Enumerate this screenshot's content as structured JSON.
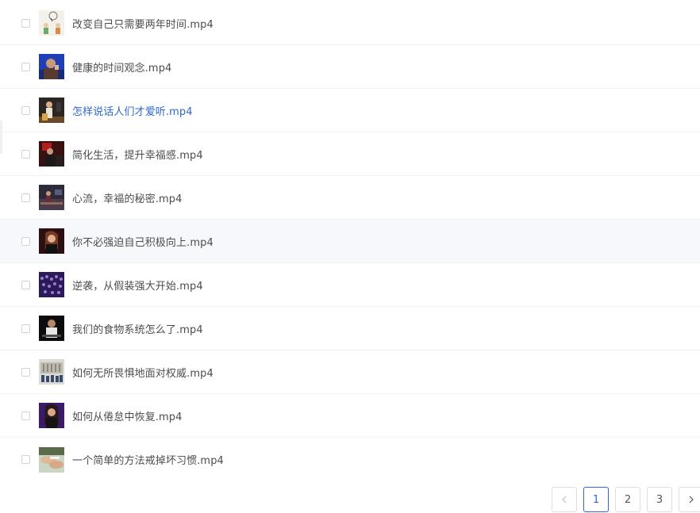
{
  "files": [
    {
      "name": "改变自己只需要两年时间.mp4",
      "thumb": "cartoon-thumbnail-icon"
    },
    {
      "name": "健康的时间观念.mp4",
      "thumb": "speaker-thumbnail-icon"
    },
    {
      "name": "怎样说话人们才爱听.mp4",
      "thumb": "speaker-thumbnail-icon"
    },
    {
      "name": "简化生活，提升幸福感.mp4",
      "thumb": "speaker-thumbnail-icon"
    },
    {
      "name": "心流，幸福的秘密.mp4",
      "thumb": "stage-thumbnail-icon"
    },
    {
      "name": "你不必强迫自己积极向上.mp4",
      "thumb": "speaker-thumbnail-icon"
    },
    {
      "name": "逆袭，从假装强大开始.mp4",
      "thumb": "audience-thumbnail-icon"
    },
    {
      "name": "我们的食物系统怎么了.mp4",
      "thumb": "speaker-thumbnail-icon"
    },
    {
      "name": "如何无所畏惧地面对权威.mp4",
      "thumb": "building-thumbnail-icon"
    },
    {
      "name": "如何从倦怠中恢复.mp4",
      "thumb": "speaker-thumbnail-icon"
    },
    {
      "name": "一个简单的方法戒掉坏习惯.mp4",
      "thumb": "hands-thumbnail-icon"
    }
  ],
  "pagination": {
    "prev_icon": "chevron-left-icon",
    "next_icon": "chevron-right-icon",
    "pages": [
      "1",
      "2",
      "3"
    ],
    "current": "1"
  },
  "colors": {
    "link_active": "#2d68c9",
    "text": "#4c4c4c",
    "row_hover": "#f7f8fb"
  }
}
